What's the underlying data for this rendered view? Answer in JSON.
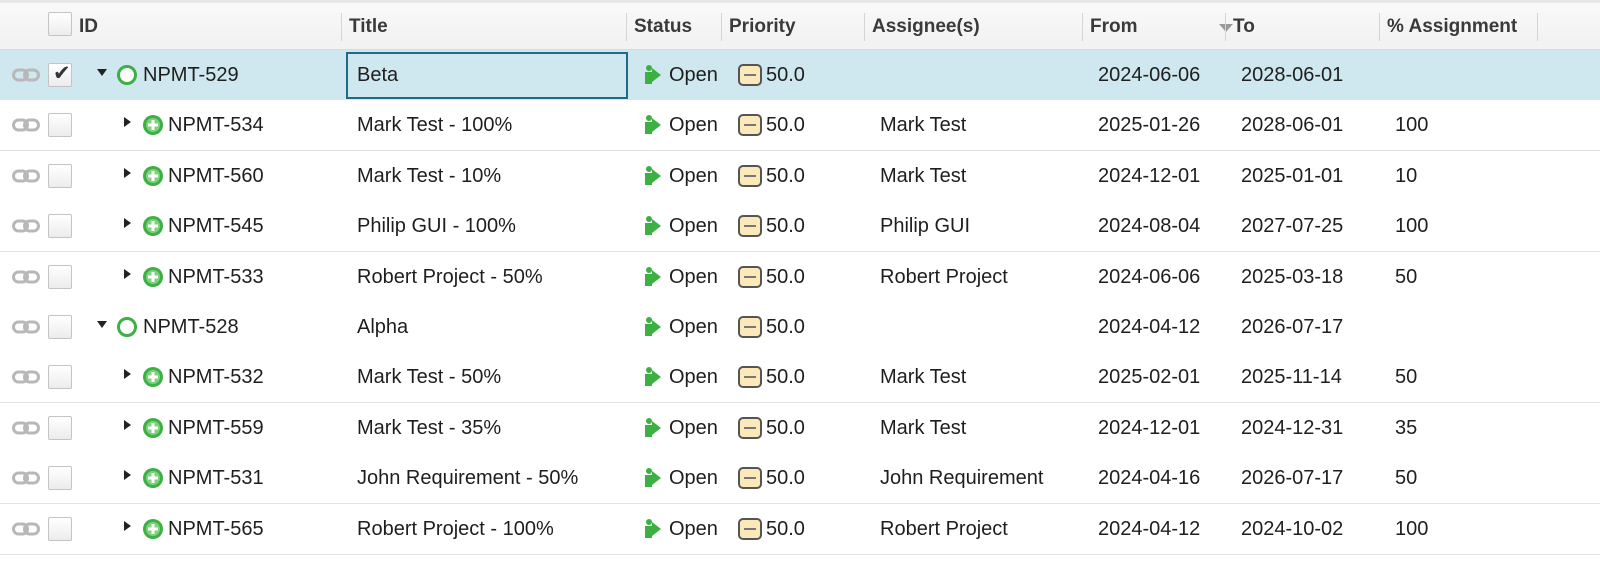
{
  "header": {
    "id": "ID",
    "title": "Title",
    "status": "Status",
    "priority": "Priority",
    "assignees": "Assignee(s)",
    "from": "From",
    "to": "To",
    "assignment": "% Assignment"
  },
  "colors": {
    "selected_row": "#cfe7ee",
    "edit_border": "#1f6a86",
    "status_green": "#3cb043",
    "priority_fill": "#fbe9b9"
  },
  "rows": [
    {
      "level": 0,
      "expanded": true,
      "selected": true,
      "checked": true,
      "item_icon": "open-circle-icon",
      "id": "NPMT-529",
      "title": "Beta",
      "status": "Open",
      "priority": "50.0",
      "assignee": "",
      "from": "2024-06-06",
      "to": "2028-06-01",
      "assignment": ""
    },
    {
      "level": 1,
      "expanded": false,
      "selected": false,
      "checked": false,
      "item_icon": "green-plus-circle-icon",
      "id": "NPMT-534",
      "title": "Mark Test - 100%",
      "status": "Open",
      "priority": "50.0",
      "assignee": "Mark Test",
      "from": "2025-01-26",
      "to": "2028-06-01",
      "assignment": "100"
    },
    {
      "level": 1,
      "expanded": false,
      "selected": false,
      "checked": false,
      "item_icon": "green-plus-circle-icon",
      "id": "NPMT-560",
      "title": "Mark Test - 10%",
      "status": "Open",
      "priority": "50.0",
      "assignee": "Mark Test",
      "from": "2024-12-01",
      "to": "2025-01-01",
      "assignment": "10"
    },
    {
      "level": 1,
      "expanded": false,
      "selected": false,
      "checked": false,
      "item_icon": "green-plus-circle-icon",
      "id": "NPMT-545",
      "title": "Philip GUI - 100%",
      "status": "Open",
      "priority": "50.0",
      "assignee": "Philip GUI",
      "from": "2024-08-04",
      "to": "2027-07-25",
      "assignment": "100"
    },
    {
      "level": 1,
      "expanded": false,
      "selected": false,
      "checked": false,
      "item_icon": "green-plus-circle-icon",
      "id": "NPMT-533",
      "title": "Robert Project - 50%",
      "status": "Open",
      "priority": "50.0",
      "assignee": "Robert Project",
      "from": "2024-06-06",
      "to": "2025-03-18",
      "assignment": "50"
    },
    {
      "level": 0,
      "expanded": true,
      "selected": false,
      "checked": false,
      "item_icon": "open-circle-icon",
      "id": "NPMT-528",
      "title": "Alpha",
      "status": "Open",
      "priority": "50.0",
      "assignee": "",
      "from": "2024-04-12",
      "to": "2026-07-17",
      "assignment": ""
    },
    {
      "level": 1,
      "expanded": false,
      "selected": false,
      "checked": false,
      "item_icon": "green-plus-circle-icon",
      "id": "NPMT-532",
      "title": "Mark Test - 50%",
      "status": "Open",
      "priority": "50.0",
      "assignee": "Mark Test",
      "from": "2025-02-01",
      "to": "2025-11-14",
      "assignment": "50"
    },
    {
      "level": 1,
      "expanded": false,
      "selected": false,
      "checked": false,
      "item_icon": "green-plus-circle-icon",
      "id": "NPMT-559",
      "title": "Mark Test - 35%",
      "status": "Open",
      "priority": "50.0",
      "assignee": "Mark Test",
      "from": "2024-12-01",
      "to": "2024-12-31",
      "assignment": "35"
    },
    {
      "level": 1,
      "expanded": false,
      "selected": false,
      "checked": false,
      "item_icon": "green-plus-circle-icon",
      "id": "NPMT-531",
      "title": "John Requirement - 50%",
      "status": "Open",
      "priority": "50.0",
      "assignee": "John Requirement",
      "from": "2024-04-16",
      "to": "2026-07-17",
      "assignment": "50"
    },
    {
      "level": 1,
      "expanded": false,
      "selected": false,
      "checked": false,
      "item_icon": "green-plus-circle-icon",
      "id": "NPMT-565",
      "title": "Robert Project - 100%",
      "status": "Open",
      "priority": "50.0",
      "assignee": "Robert Project",
      "from": "2024-04-12",
      "to": "2024-10-02",
      "assignment": "100"
    }
  ]
}
